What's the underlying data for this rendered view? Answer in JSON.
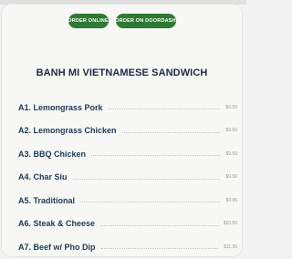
{
  "buttons": {
    "order_label": "ORDER ONLINE",
    "doordash_label": "ORDER ON DOORDASH"
  },
  "section": {
    "title": "BANH MI VIETNAMESE SANDWICH"
  },
  "menu": {
    "items": [
      {
        "name": "A1. Lemongrass Pork",
        "price": "$9.50"
      },
      {
        "name": "A2. Lemongrass Chicken",
        "price": "$9.50"
      },
      {
        "name": "A3. BBQ Chicken",
        "price": "$9.50"
      },
      {
        "name": "A4. Char Siu",
        "price": "$9.50"
      },
      {
        "name": "A5. Traditional",
        "price": "$9.95"
      },
      {
        "name": "A6. Steak & Cheese",
        "price": "$10.50"
      },
      {
        "name": "A7. Beef w/ Pho Dip",
        "price": "$11.95"
      }
    ]
  },
  "colors": {
    "button_green": "#2e7a34",
    "title_navy": "#1b2b44",
    "item_text": "#1c3a55",
    "price_gray": "#9a9a9a"
  }
}
